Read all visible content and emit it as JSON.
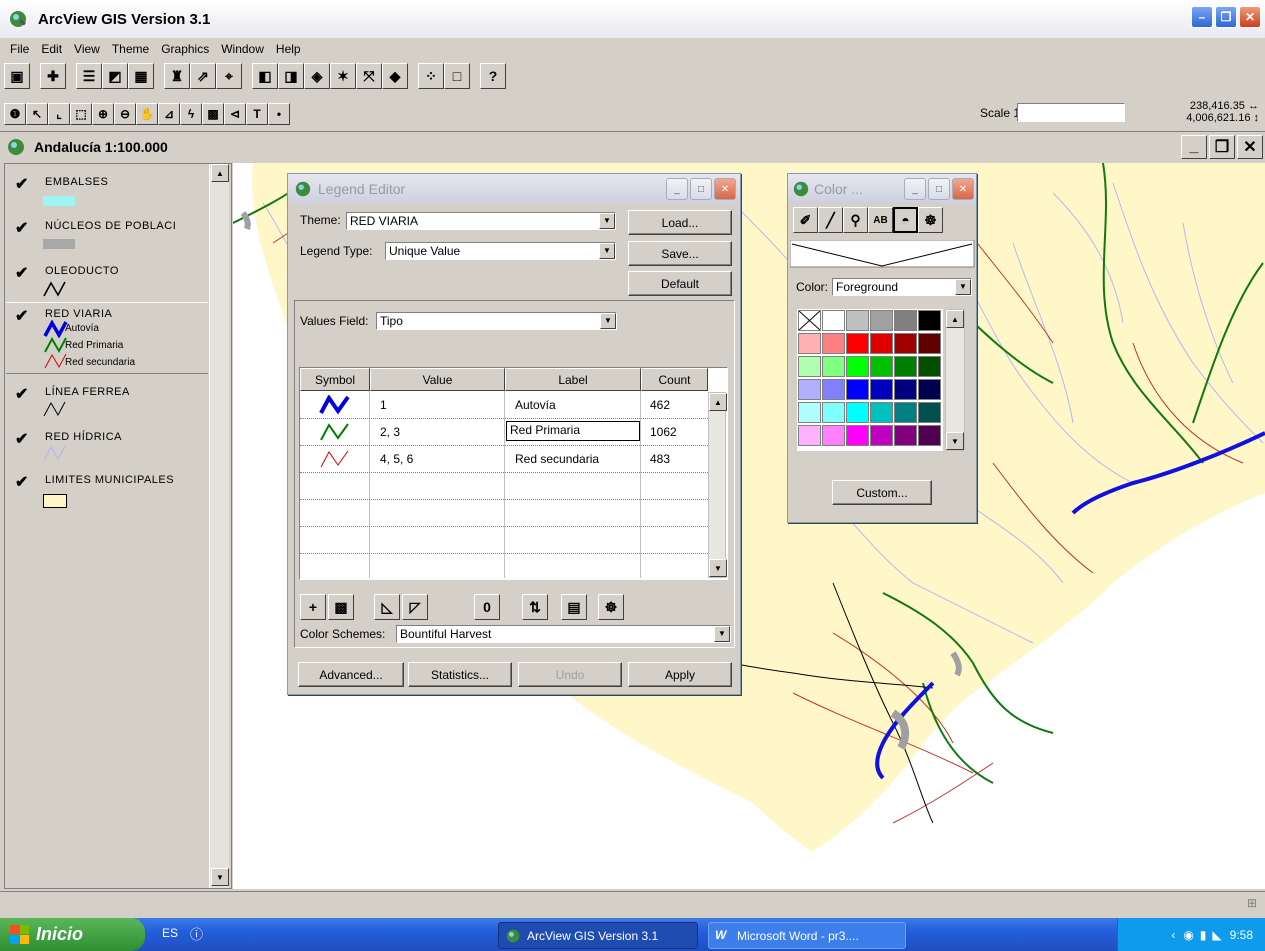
{
  "window": {
    "title": "ArcView GIS Version 3.1"
  },
  "menu": [
    "File",
    "Edit",
    "View",
    "Theme",
    "Graphics",
    "Window",
    "Help"
  ],
  "toolbar": {
    "scale_label": "Scale 1:",
    "scale_value": "",
    "coord_x": "238,416.35",
    "coord_y": "4,006,621.16"
  },
  "view": {
    "title": "Andalucía 1:100.000"
  },
  "toc": {
    "themes": [
      {
        "name": "EMBALSES",
        "color": "#9ff4f4"
      },
      {
        "name": "NÚCLEOS DE POBLACI",
        "color": "#a8a8a8"
      },
      {
        "name": "OLEODUCTO",
        "color": "#000000"
      },
      {
        "name": "RED VIARIA",
        "color": "#0000e0",
        "classes": [
          "Autovía",
          "Red Primaria",
          "Red secundaria"
        ]
      },
      {
        "name": "LÍNEA FERREA",
        "color": "#000000"
      },
      {
        "name": "RED HÍDRICA",
        "color": "#b0b4f8"
      },
      {
        "name": "LIMITES MUNICIPALES",
        "color": "#fff7c8"
      }
    ]
  },
  "legend_editor": {
    "title": "Legend Editor",
    "theme_label": "Theme:",
    "theme_value": "RED VIARIA",
    "legend_type_label": "Legend Type:",
    "legend_type_value": "Unique Value",
    "load": "Load...",
    "save": "Save...",
    "default": "Default",
    "values_field_label": "Values Field:",
    "values_field_value": "Tipo",
    "columns": [
      "Symbol",
      "Value",
      "Label",
      "Count"
    ],
    "rows": [
      {
        "symbol_color": "#0000e0",
        "value": "1",
        "label": "Autovía",
        "count": "462"
      },
      {
        "symbol_color": "#008000",
        "value": "2, 3",
        "label": "Red Primaria",
        "count": "1062"
      },
      {
        "symbol_color": "#e00000",
        "value": "4, 5, 6",
        "label": "Red secundaria",
        "count": "483"
      }
    ],
    "color_schemes_label": "Color Schemes:",
    "color_schemes_value": "Bountiful Harvest",
    "advanced": "Advanced...",
    "statistics": "Statistics...",
    "undo": "Undo",
    "apply": "Apply"
  },
  "color_palette": {
    "title": "Color ...",
    "color_label": "Color:",
    "color_value": "Foreground",
    "custom": "Custom...",
    "swatches": [
      [
        "none",
        "#ffffff",
        "#c0c0c0",
        "#a0a0a0",
        "#808080",
        "#000000"
      ],
      [
        "#ffb0b0",
        "#ff8080",
        "#ff0000",
        "#e00000",
        "#a00000",
        "#600000"
      ],
      [
        "#b0ffb0",
        "#80ff80",
        "#00ff00",
        "#00c000",
        "#008000",
        "#005000"
      ],
      [
        "#b0b0ff",
        "#8080ff",
        "#0000ff",
        "#0000c0",
        "#000080",
        "#000050"
      ],
      [
        "#b0ffff",
        "#80ffff",
        "#00ffff",
        "#00c0c0",
        "#008080",
        "#005050"
      ],
      [
        "#ffb0ff",
        "#ff80ff",
        "#ff00ff",
        "#c000c0",
        "#800080",
        "#500050"
      ]
    ]
  },
  "taskbar": {
    "start": "Inicio",
    "lang": "ES",
    "tasks": [
      "ArcView GIS Version 3.1",
      "Microsoft Word - pr3...."
    ],
    "clock": "9:58"
  }
}
